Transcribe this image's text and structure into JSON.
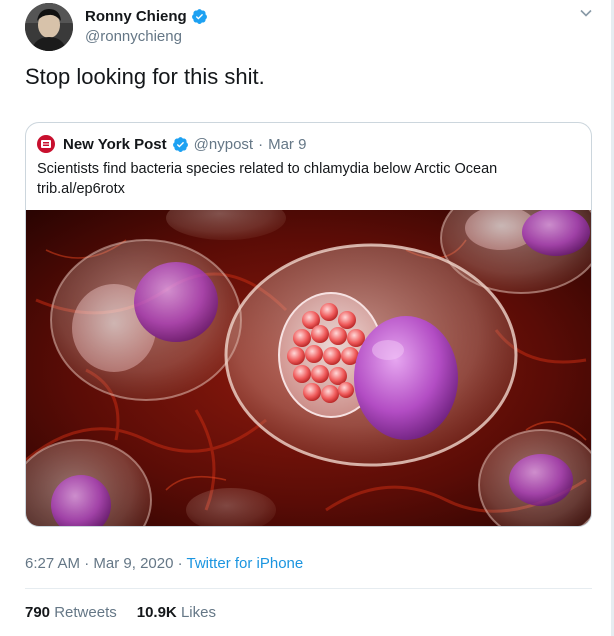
{
  "author": {
    "name": "Ronny Chieng",
    "handle": "@ronnychieng"
  },
  "tweet_text": "Stop looking for this shit.",
  "quoted": {
    "name": "New York Post",
    "handle": "@nypost",
    "sep": "·",
    "date": "Mar 9",
    "text": "Scientists find bacteria species related to chlamydia below Arctic Ocean",
    "link": "trib.al/ep6rotx"
  },
  "meta": {
    "time": "6:27 AM",
    "sep1": "·",
    "date": "Mar 9, 2020",
    "sep2": "·",
    "source": "Twitter for iPhone"
  },
  "stats": {
    "retweets_count": "790",
    "retweets_label": "Retweets",
    "likes_count": "10.9K",
    "likes_label": "Likes"
  },
  "icons": {
    "verified": "verified-badge-icon",
    "menu": "chevron-down-icon"
  },
  "colors": {
    "link": "#1b95e0",
    "muted": "#657786",
    "verified": "#1da1f2",
    "nypost": "#c8102e"
  }
}
